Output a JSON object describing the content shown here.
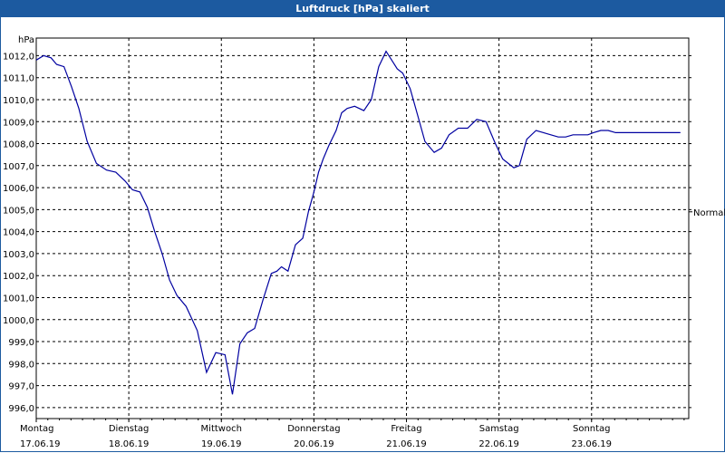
{
  "window": {
    "title": "Luftdruck [hPa] skaliert"
  },
  "chart_data": {
    "type": "line",
    "ylabel": "hPa",
    "ylim": [
      995.8,
      1012.2
    ],
    "xlim": [
      0,
      7
    ],
    "grid": true,
    "y_ticks": [
      "1012,0",
      "1011,0",
      "1010,0",
      "1009,0",
      "1008,0",
      "1007,0",
      "1006,0",
      "1005,0",
      "1004,0",
      "1003,0",
      "1002,0",
      "1001,0",
      "1000,0",
      "999,0",
      "998,0",
      "997,0",
      "996,0"
    ],
    "y_tick_values": [
      1012,
      1011,
      1010,
      1009,
      1008,
      1007,
      1006,
      1005,
      1004,
      1003,
      1002,
      1001,
      1000,
      999,
      998,
      997,
      996
    ],
    "x_ticks": [
      {
        "day": "Montag",
        "date": "17.06.19"
      },
      {
        "day": "Dienstag",
        "date": "18.06.19"
      },
      {
        "day": "Mittwoch",
        "date": "19.06.19"
      },
      {
        "day": "Donnerstag",
        "date": "20.06.19"
      },
      {
        "day": "Freitag",
        "date": "21.06.19"
      },
      {
        "day": "Samstag",
        "date": "22.06.19"
      },
      {
        "day": "Sonntag",
        "date": "23.06.19"
      }
    ],
    "reference_line": {
      "label": "Normal",
      "value": 1004.9
    },
    "series": [
      {
        "color": "#0000a0",
        "x": [
          0.0,
          0.08,
          0.16,
          0.22,
          0.3,
          0.38,
          0.46,
          0.55,
          0.65,
          0.76,
          0.86,
          0.96,
          1.04,
          1.12,
          1.2,
          1.28,
          1.36,
          1.44,
          1.52,
          1.62,
          1.74,
          1.84,
          1.94,
          2.04,
          2.12,
          2.2,
          2.28,
          2.36,
          2.45,
          2.54,
          2.6,
          2.65,
          2.72,
          2.8,
          2.88,
          2.94,
          3.0,
          3.05,
          3.1,
          3.16,
          3.24,
          3.3,
          3.36,
          3.44,
          3.54,
          3.62,
          3.7,
          3.78,
          3.84,
          3.9,
          3.96,
          4.04,
          4.12,
          4.2,
          4.3,
          4.38,
          4.46,
          4.56,
          4.66,
          4.76,
          4.86,
          4.96,
          5.04,
          5.1,
          5.16,
          5.22,
          5.3,
          5.4,
          5.48,
          5.56,
          5.64,
          5.72,
          5.8,
          5.88,
          5.96,
          6.02,
          6.1,
          6.18,
          6.26,
          6.34,
          6.42,
          6.5,
          6.58,
          6.66,
          6.74,
          6.82,
          6.9,
          6.96
        ],
        "y": [
          1011.8,
          1012.0,
          1011.9,
          1011.6,
          1011.5,
          1010.6,
          1009.6,
          1008.1,
          1007.1,
          1006.8,
          1006.7,
          1006.3,
          1005.9,
          1005.8,
          1005.1,
          1004.0,
          1003.0,
          1001.8,
          1001.1,
          1000.6,
          999.5,
          997.6,
          998.5,
          998.4,
          996.6,
          998.9,
          999.4,
          999.6,
          1000.9,
          1002.1,
          1002.2,
          1002.4,
          1002.2,
          1003.4,
          1003.7,
          1004.9,
          1005.8,
          1006.7,
          1007.3,
          1007.9,
          1008.6,
          1009.4,
          1009.6,
          1009.7,
          1009.5,
          1010.0,
          1011.5,
          1012.2,
          1011.8,
          1011.4,
          1011.2,
          1010.5,
          1009.3,
          1008.1,
          1007.6,
          1007.8,
          1008.4,
          1008.7,
          1008.7,
          1009.1,
          1009.0,
          1008.0,
          1007.3,
          1007.1,
          1006.9,
          1007.0,
          1008.2,
          1008.6,
          1008.5,
          1008.4,
          1008.3,
          1008.3,
          1008.4,
          1008.4,
          1008.4,
          1008.5,
          1008.6,
          1008.6,
          1008.5,
          1008.5,
          1008.5,
          1008.5,
          1008.5,
          1008.5,
          1008.5,
          1008.5,
          1008.5,
          1008.5
        ]
      }
    ]
  }
}
